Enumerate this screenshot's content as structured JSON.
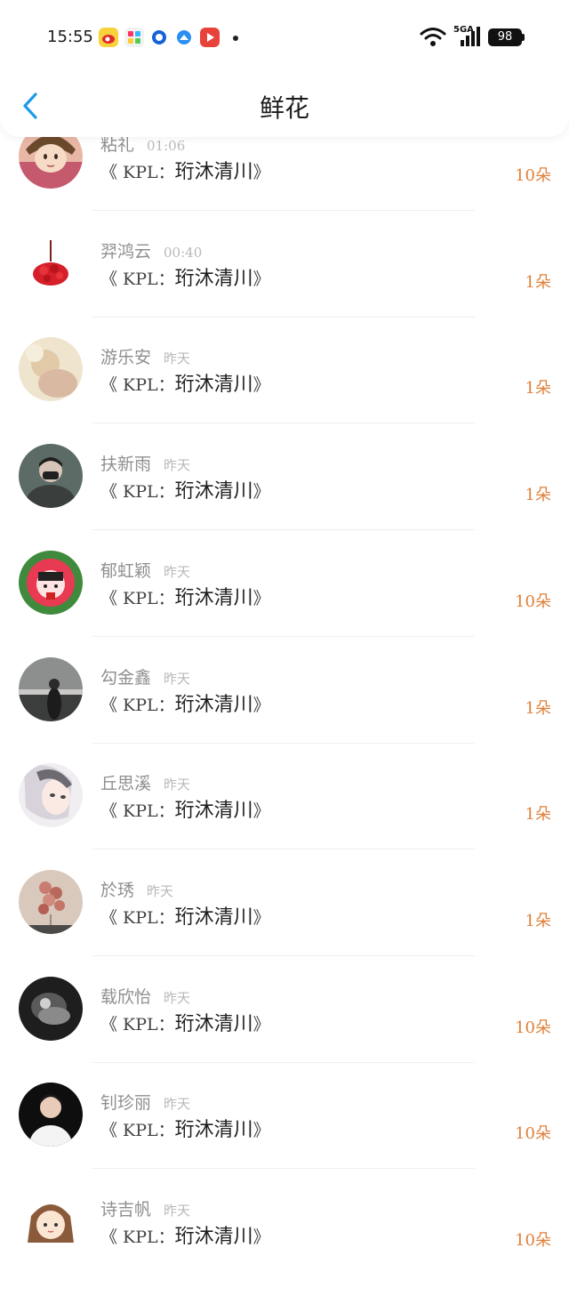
{
  "status_bar": {
    "time": "15:55",
    "network": "5GA",
    "battery": "98",
    "app_icons": [
      "weibo-icon",
      "gallery-icon",
      "browser-icon",
      "messenger-icon",
      "video-icon"
    ]
  },
  "header": {
    "title": "鲜花",
    "back_icon": "chevron-left-icon"
  },
  "colors": {
    "accent": "#1e9ae6",
    "quantity": "#e0803a",
    "name": "#8f8f8f",
    "time": "#b8b8b8"
  },
  "flowers": [
    {
      "name": "粘礼",
      "time": "01:06",
      "prefix": "《 KPL：",
      "target": "珩沐清川",
      "suffix": "》",
      "qty": "10朵",
      "avatar": "anime-girl-avatar"
    },
    {
      "name": "羿鸿云",
      "time": "00:40",
      "prefix": "《 KPL：",
      "target": "珩沐清川",
      "suffix": "》",
      "qty": "1朵",
      "avatar": "rose-bouquet-avatar"
    },
    {
      "name": "游乐安",
      "time": "昨天",
      "prefix": "《 KPL：",
      "target": "珩沐清川",
      "suffix": "》",
      "qty": "1朵",
      "avatar": "soft-photo-avatar"
    },
    {
      "name": "扶新雨",
      "time": "昨天",
      "prefix": "《 KPL：",
      "target": "珩沐清川",
      "suffix": "》",
      "qty": "1朵",
      "avatar": "masked-man-avatar"
    },
    {
      "name": "郁虹颖",
      "time": "昨天",
      "prefix": "《 KPL：",
      "target": "珩沐清川",
      "suffix": "》",
      "qty": "10朵",
      "avatar": "cartoon-girl-avatar"
    },
    {
      "name": "勾金鑫",
      "time": "昨天",
      "prefix": "《 KPL：",
      "target": "珩沐清川",
      "suffix": "》",
      "qty": "1朵",
      "avatar": "landscape-person-avatar"
    },
    {
      "name": "丘思溪",
      "time": "昨天",
      "prefix": "《 KPL：",
      "target": "珩沐清川",
      "suffix": "》",
      "qty": "1朵",
      "avatar": "illustrated-girl-avatar"
    },
    {
      "name": "於琇",
      "time": "昨天",
      "prefix": "《 KPL：",
      "target": "珩沐清川",
      "suffix": "》",
      "qty": "1朵",
      "avatar": "balloons-avatar"
    },
    {
      "name": "载欣怡",
      "time": "昨天",
      "prefix": "《 KPL：",
      "target": "珩沐清川",
      "suffix": "》",
      "qty": "10朵",
      "avatar": "monochrome-avatar"
    },
    {
      "name": "钊珍丽",
      "time": "昨天",
      "prefix": "《 KPL：",
      "target": "珩沐清川",
      "suffix": "》",
      "qty": "10朵",
      "avatar": "portrait-man-avatar"
    },
    {
      "name": "诗吉帆",
      "time": "昨天",
      "prefix": "《 KPL：",
      "target": "珩沐清川",
      "suffix": "》",
      "qty": "10朵",
      "avatar": "chibi-girl-avatar"
    }
  ]
}
